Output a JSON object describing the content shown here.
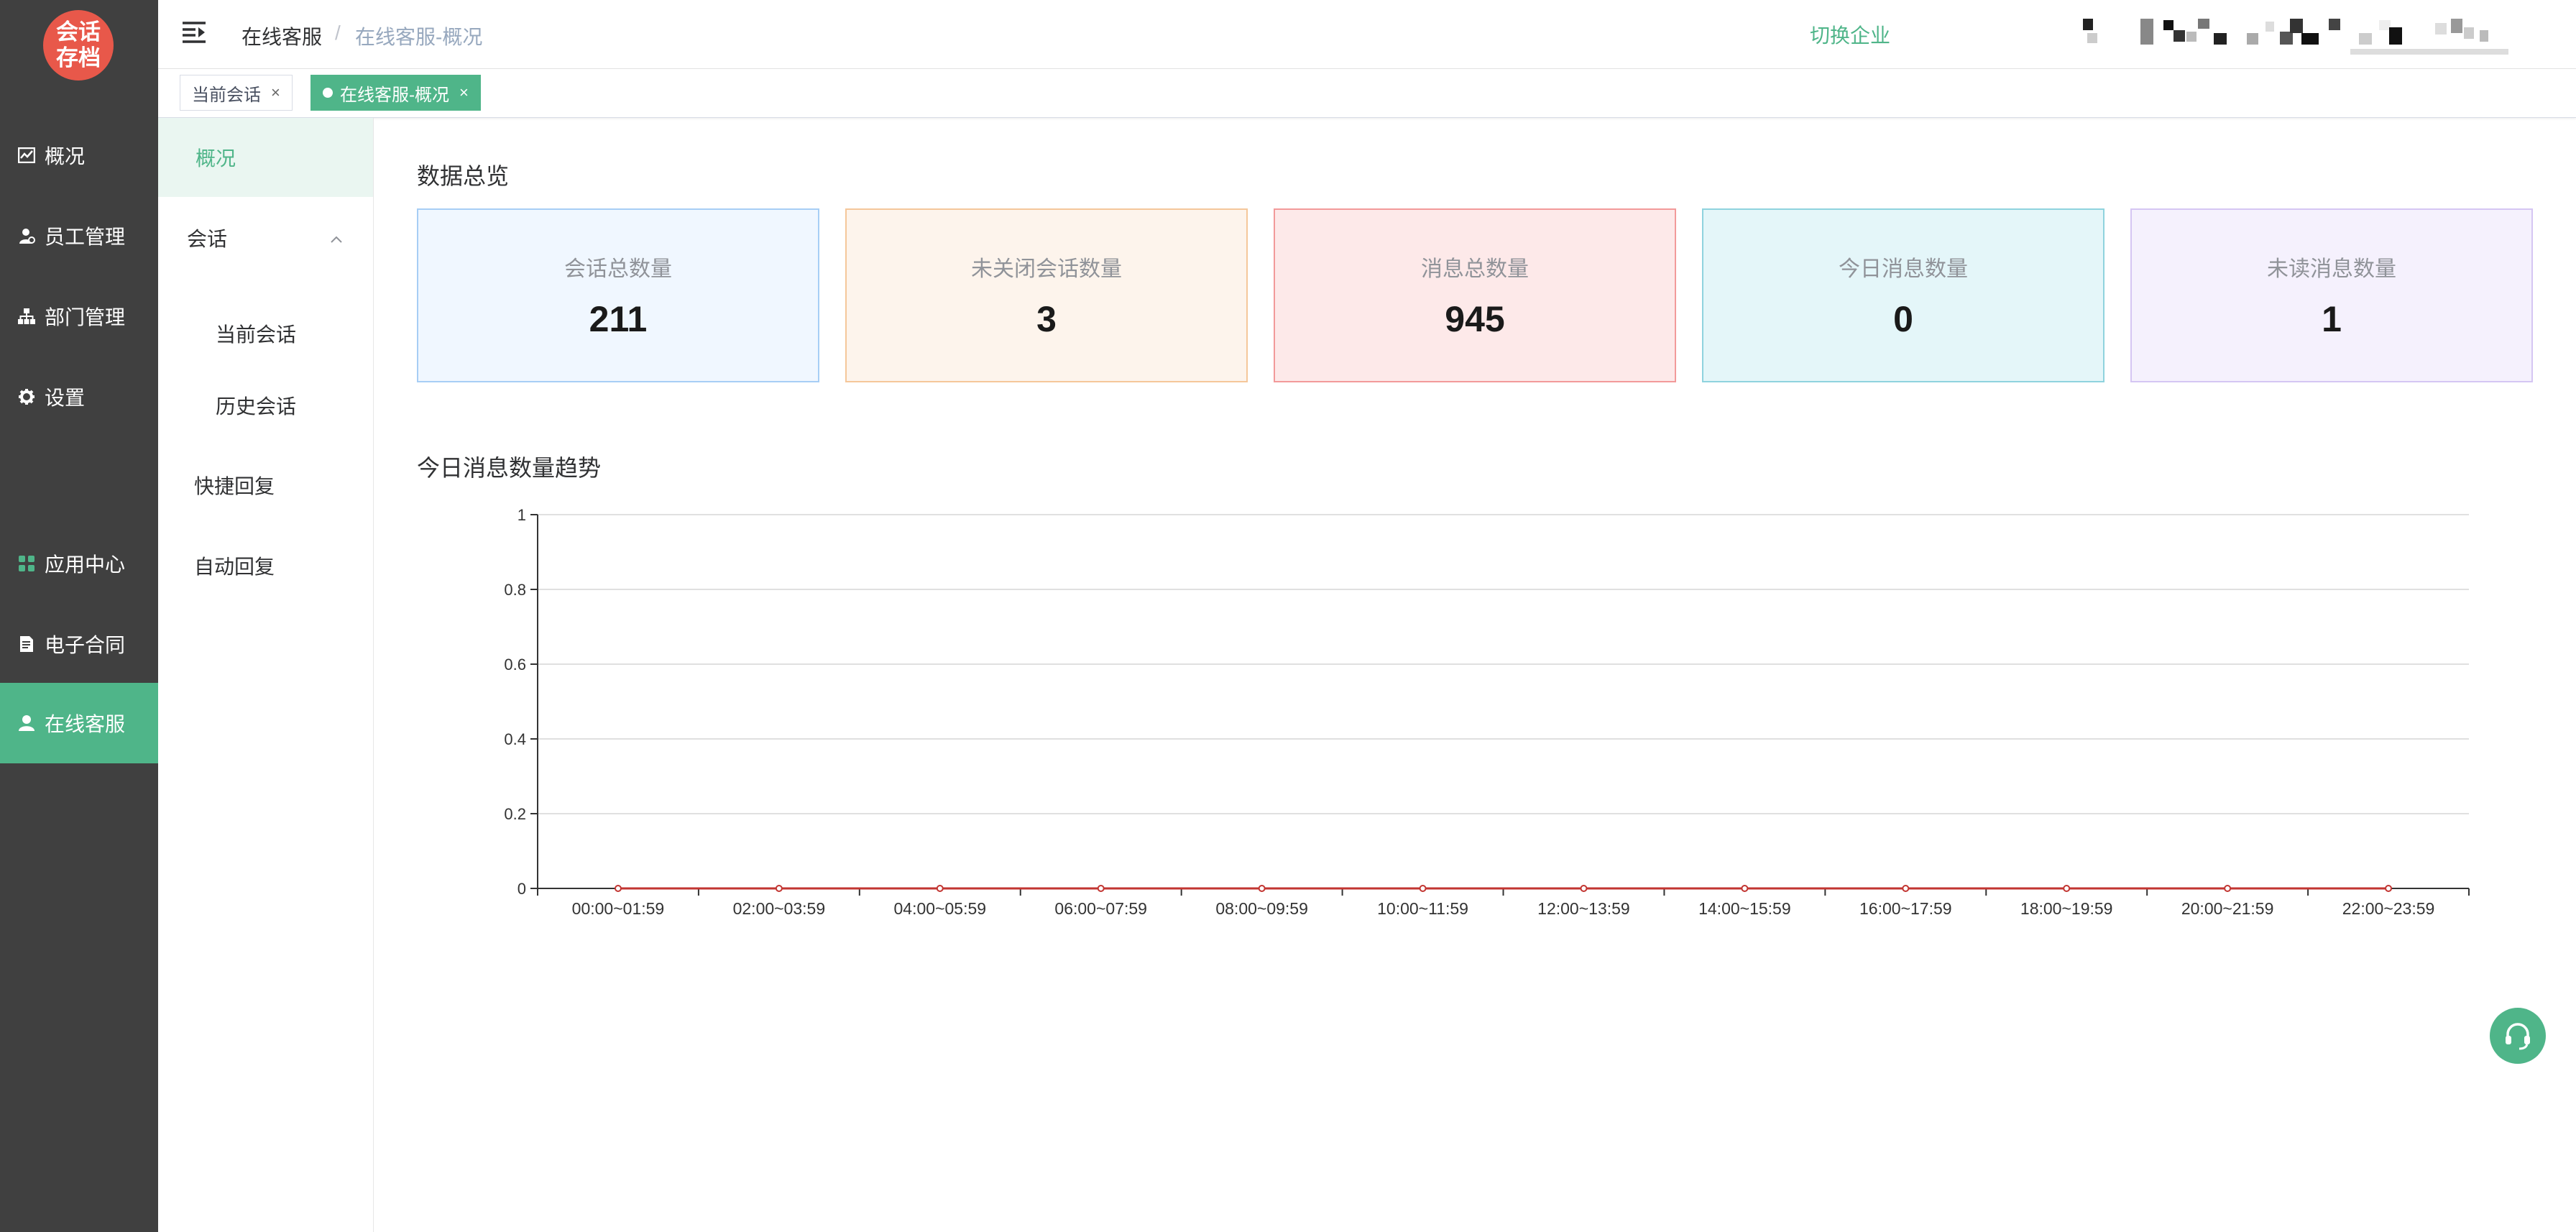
{
  "app": {
    "logo_text": "会话\n存档",
    "colors": {
      "accent": "#4fb589",
      "sidebar_bg": "#404040",
      "logo_bg": "#e8584a",
      "line": "#c23531"
    }
  },
  "sidebar": {
    "items": [
      {
        "label": "概况",
        "icon": "chart-line-icon"
      },
      {
        "label": "员工管理",
        "icon": "user-icon"
      },
      {
        "label": "部门管理",
        "icon": "org-chart-icon"
      },
      {
        "label": "设置",
        "icon": "gear-icon"
      },
      {
        "label": "应用中心",
        "icon": "apps-grid-icon"
      },
      {
        "label": "电子合同",
        "icon": "document-icon"
      },
      {
        "label": "在线客服",
        "icon": "person-icon",
        "active": true
      }
    ]
  },
  "header": {
    "breadcrumb": [
      "在线客服",
      "在线客服-概况"
    ],
    "breadcrumb_sep": "/",
    "switch_enterprise": "切换企业"
  },
  "tags": [
    {
      "label": "当前会话",
      "close": "×"
    },
    {
      "label": "在线客服-概况",
      "close": "×",
      "active": true
    }
  ],
  "submenu": {
    "items": [
      {
        "label": "概况",
        "active": true
      },
      {
        "label": "会话",
        "expanded": true
      },
      {
        "label": "当前会话",
        "child": true
      },
      {
        "label": "历史会话",
        "child": true
      },
      {
        "label": "快捷回复"
      },
      {
        "label": "自动回复"
      }
    ]
  },
  "overview": {
    "title": "数据总览",
    "cards": [
      {
        "title": "会话总数量",
        "value": "211",
        "bg": "#f0f7ff",
        "border": "#a7cef5"
      },
      {
        "title": "未关闭会话数量",
        "value": "3",
        "bg": "#fdf4ec",
        "border": "#f5c79a"
      },
      {
        "title": "消息总数量",
        "value": "945",
        "bg": "#fde9e9",
        "border": "#f29a9a"
      },
      {
        "title": "今日消息数量",
        "value": "0",
        "bg": "#e4f6f9",
        "border": "#8fd3de"
      },
      {
        "title": "未读消息数量",
        "value": "1",
        "bg": "#f5f1fd",
        "border": "#d5c6f3"
      }
    ]
  },
  "trend": {
    "title": "今日消息数量趋势"
  },
  "chart_data": {
    "type": "line",
    "title": "",
    "categories": [
      "00:00~01:59",
      "02:00~03:59",
      "04:00~05:59",
      "06:00~07:59",
      "08:00~09:59",
      "10:00~11:59",
      "12:00~13:59",
      "14:00~15:59",
      "16:00~17:59",
      "18:00~19:59",
      "20:00~21:59",
      "22:00~23:59"
    ],
    "series": [
      {
        "values": [
          0,
          0,
          0,
          0,
          0,
          0,
          0,
          0,
          0,
          0,
          0,
          0
        ]
      }
    ],
    "yticks": [
      "0",
      "0.2",
      "0.4",
      "0.6",
      "0.8",
      "1"
    ],
    "ylim": [
      0,
      1
    ],
    "grid": true
  }
}
